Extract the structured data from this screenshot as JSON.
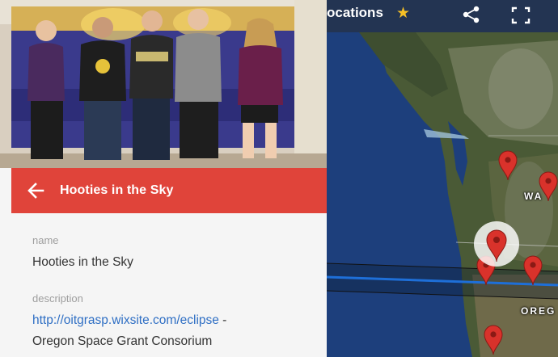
{
  "map": {
    "title": "ocations",
    "star_icon": "star-icon",
    "share_icon": "share-icon",
    "fullscreen_icon": "fullscreen-icon",
    "labels": {
      "washington": "WA",
      "oregon": "OREG"
    },
    "pin_color": "#d9322b"
  },
  "panel": {
    "header": {
      "title": "Hooties in the Sky",
      "back_icon": "arrow-back-icon",
      "color": "#e0443a"
    },
    "photo_alt": "group photo of five people",
    "fields": {
      "name_label": "name",
      "name_value": "Hooties in the Sky",
      "description_label": "description",
      "description_link": "http://oitgrasp.wixsite.com/eclipse",
      "description_sep": " -",
      "description_text": "Oregon Space Grant Consorium"
    }
  }
}
